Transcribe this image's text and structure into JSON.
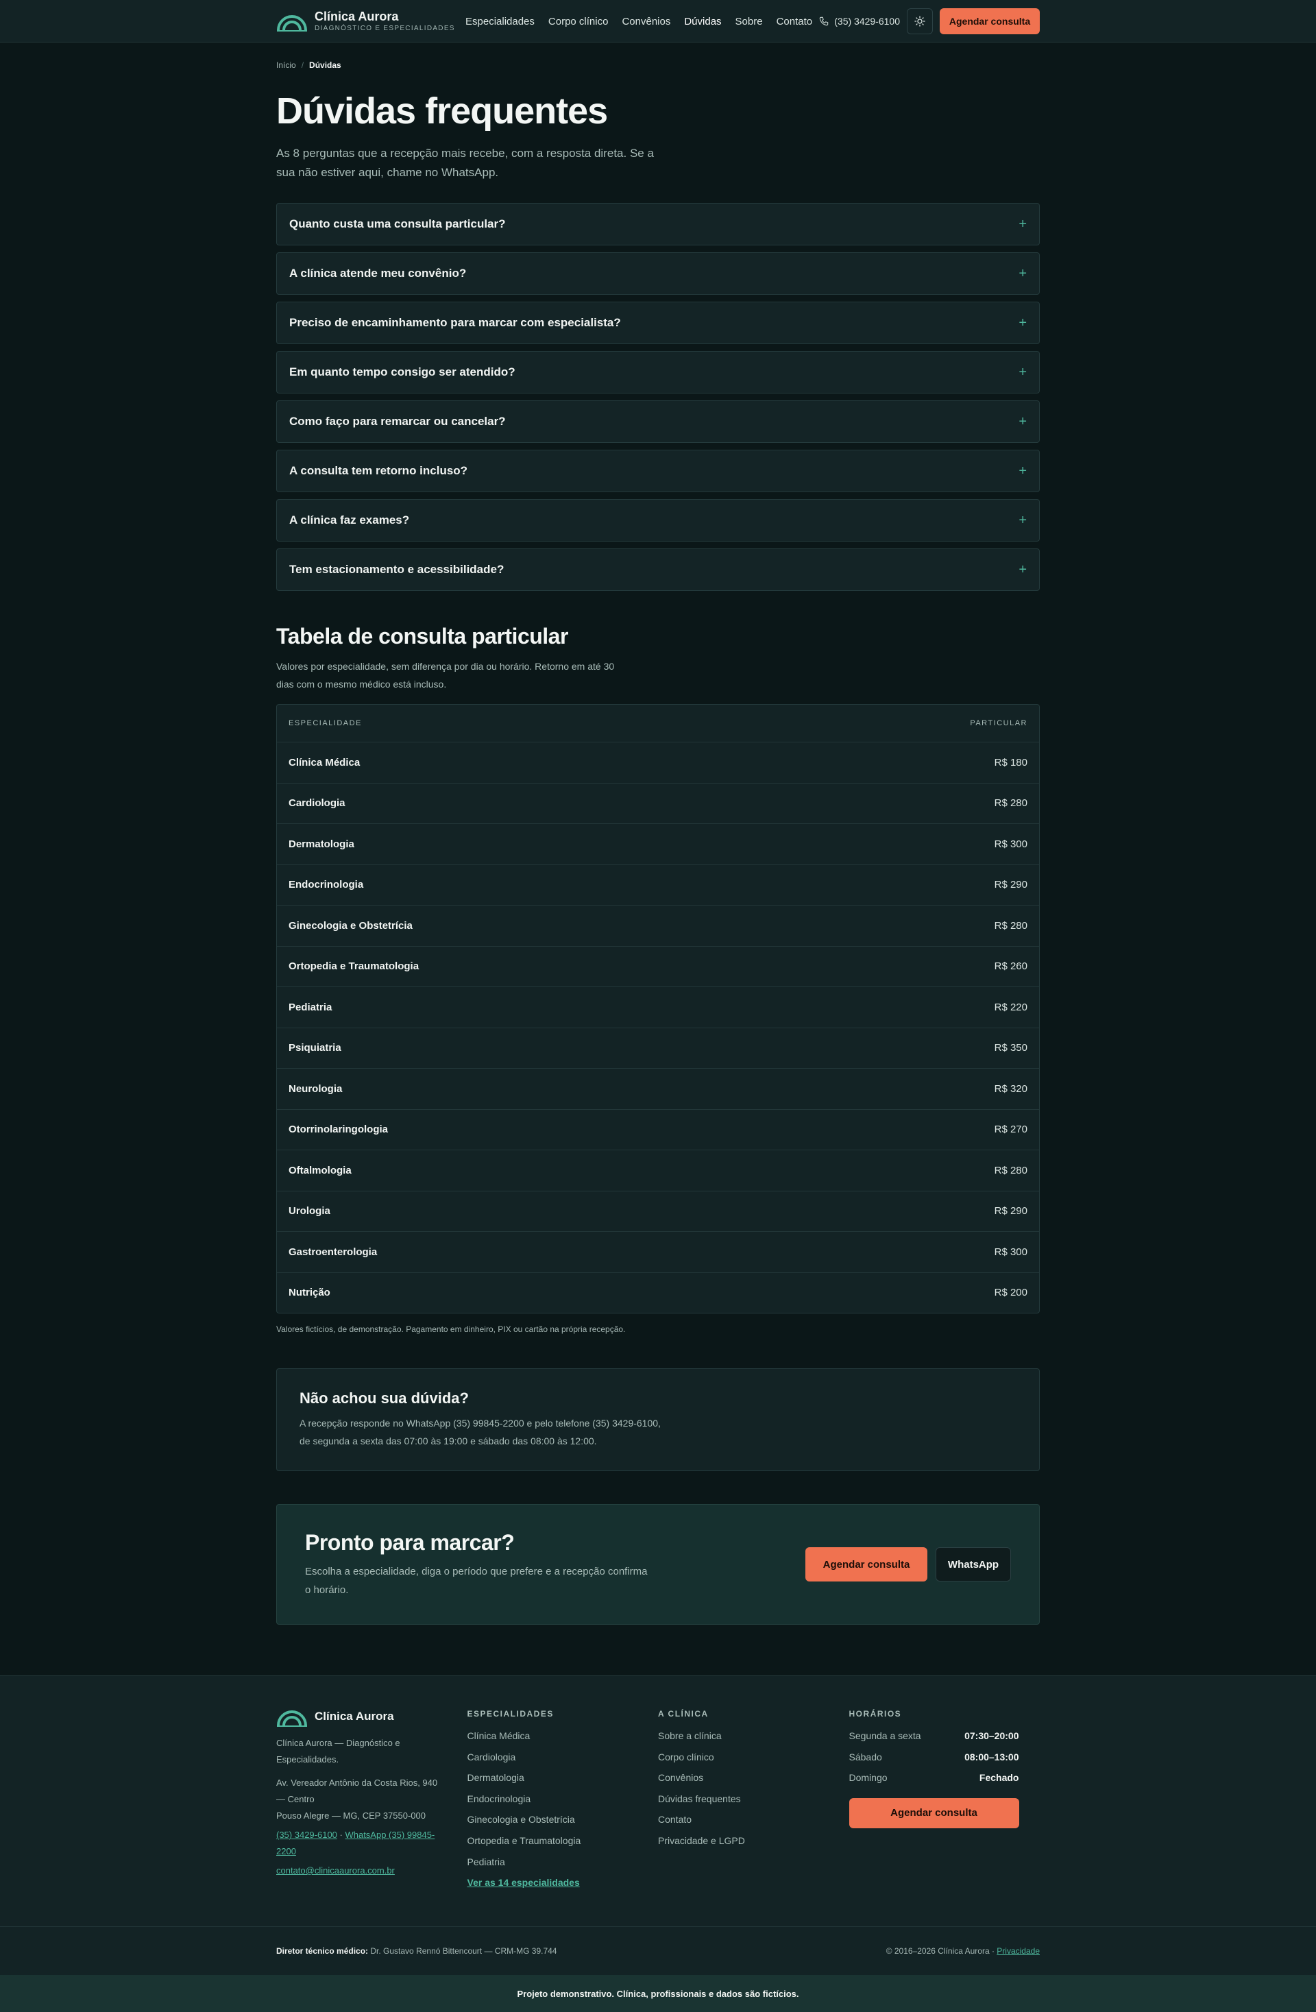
{
  "header": {
    "brand_name": "Clínica Aurora",
    "brand_tagline": "DIAGNÓSTICO E ESPECIALIDADES",
    "nav": [
      "Especialidades",
      "Corpo clínico",
      "Convênios",
      "Dúvidas",
      "Sobre",
      "Contato"
    ],
    "phone": "(35) 3429-6100",
    "cta": "Agendar consulta"
  },
  "breadcrumb": {
    "home": "Início",
    "sep": "/",
    "current": "Dúvidas"
  },
  "page": {
    "title": "Dúvidas frequentes",
    "lead": "As 8 perguntas que a recepção mais recebe, com a resposta direta. Se a sua não estiver aqui, chame no WhatsApp."
  },
  "faq": [
    "Quanto custa uma consulta particular?",
    "A clínica atende meu convênio?",
    "Preciso de encaminhamento para marcar com especialista?",
    "Em quanto tempo consigo ser atendido?",
    "Como faço para remarcar ou cancelar?",
    "A consulta tem retorno incluso?",
    "A clínica faz exames?",
    "Tem estacionamento e acessibilidade?"
  ],
  "faq_plus": "+",
  "prices": {
    "title": "Tabela de consulta particular",
    "subtitle": "Valores por especialidade, sem diferença por dia ou horário. Retorno em até 30 dias com o mesmo médico está incluso.",
    "col_spec": "ESPECIALIDADE",
    "col_price": "PARTICULAR",
    "rows": [
      [
        "Clínica Médica",
        "R$ 180"
      ],
      [
        "Cardiologia",
        "R$ 280"
      ],
      [
        "Dermatologia",
        "R$ 300"
      ],
      [
        "Endocrinologia",
        "R$ 290"
      ],
      [
        "Ginecologia e Obstetrícia",
        "R$ 280"
      ],
      [
        "Ortopedia e Traumatologia",
        "R$ 260"
      ],
      [
        "Pediatria",
        "R$ 220"
      ],
      [
        "Psiquiatria",
        "R$ 350"
      ],
      [
        "Neurologia",
        "R$ 320"
      ],
      [
        "Otorrinolaringologia",
        "R$ 270"
      ],
      [
        "Oftalmologia",
        "R$ 280"
      ],
      [
        "Urologia",
        "R$ 290"
      ],
      [
        "Gastroenterologia",
        "R$ 300"
      ],
      [
        "Nutrição",
        "R$ 200"
      ]
    ],
    "note": "Valores fictícios, de demonstração. Pagamento em dinheiro, PIX ou cartão na própria recepção."
  },
  "help": {
    "title": "Não achou sua dúvida?",
    "text": "A recepção responde no WhatsApp (35) 99845-2200 e pelo telefone (35) 3429-6100, de segunda a sexta das 07:00 às 19:00 e sábado das 08:00 às 12:00."
  },
  "ready": {
    "title": "Pronto para marcar?",
    "text": "Escolha a especialidade, diga o período que prefere e a recepção confirma o horário.",
    "primary": "Agendar consulta",
    "secondary": "WhatsApp"
  },
  "footer": {
    "brand_name": "Clínica Aurora",
    "desc": "Clínica Aurora — Diagnóstico e Especialidades.",
    "address1": "Av. Vereador Antônio da Costa Rios, 940 — Centro",
    "address2": "Pouso Alegre — MG, CEP 37550-000",
    "phone": "(35) 3429-6100",
    "dot": " · ",
    "whatsapp": "WhatsApp (35) 99845-2200",
    "email": "contato@clinicaaurora.com.br",
    "spec_title": "ESPECIALIDADES",
    "specs": [
      "Clínica Médica",
      "Cardiologia",
      "Dermatologia",
      "Endocrinologia",
      "Ginecologia e Obstetrícia",
      "Ortopedia e Traumatologia",
      "Pediatria"
    ],
    "specs_more": "Ver as 14 especialidades",
    "clinic_title": "A CLÍNICA",
    "clinic_links": [
      "Sobre a clínica",
      "Corpo clínico",
      "Convênios",
      "Dúvidas frequentes",
      "Contato",
      "Privacidade e LGPD"
    ],
    "hours_title": "HORÁRIOS",
    "hours": [
      [
        "Segunda a sexta",
        "07:30–20:00"
      ],
      [
        "Sábado",
        "08:00–13:00"
      ],
      [
        "Domingo",
        "Fechado"
      ]
    ],
    "cta": "Agendar consulta",
    "director_label": "Diretor técnico médico:",
    "director": "Dr. Gustavo Rennó Bittencourt — CRM-MG 39.744",
    "copyright": "© 2016–2026 Clínica Aurora · ",
    "privacy": "Privacidade",
    "demo": "Projeto demonstrativo. Clínica, profissionais e dados são fictícios."
  },
  "colors": {
    "accent": "#f07250",
    "teal": "#4fb89e",
    "bg": "#0b1718",
    "panel": "#132325"
  }
}
